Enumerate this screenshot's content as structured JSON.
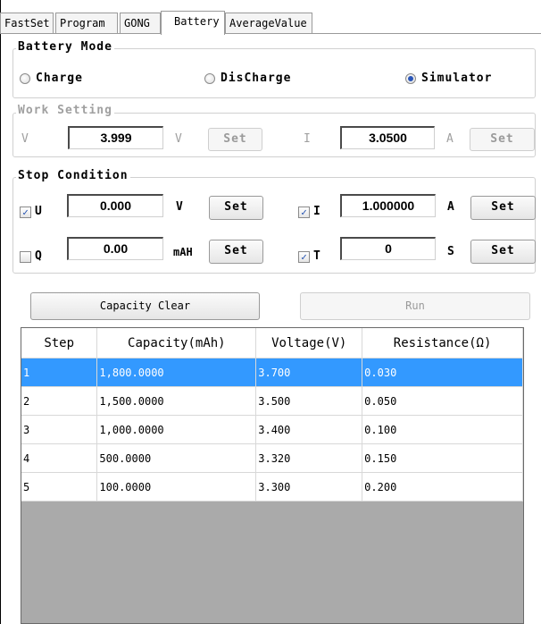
{
  "tabs": [
    {
      "label": "FastSet"
    },
    {
      "label": "Program"
    },
    {
      "label": "GONG"
    },
    {
      "label": "Battery"
    },
    {
      "label": "AverageValue"
    }
  ],
  "active_tab": "Battery",
  "battery_mode": {
    "title": "Battery Mode",
    "options": [
      "Charge",
      "DisCharge",
      "Simulator"
    ],
    "selected": "Simulator"
  },
  "work_setting": {
    "title": "Work Setting",
    "v_label": "V",
    "v_value": "3.999",
    "v_unit": "V",
    "v_set": "Set",
    "i_label": "I",
    "i_value": "3.0500",
    "i_unit": "A",
    "i_set": "Set"
  },
  "stop_condition": {
    "title": "Stop Condition",
    "u": {
      "label": "U",
      "checked": true,
      "value": "0.000",
      "unit": "V",
      "set": "Set"
    },
    "i": {
      "label": "I",
      "checked": true,
      "value": "1.000000",
      "unit": "A",
      "set": "Set"
    },
    "q": {
      "label": "Q",
      "checked": false,
      "value": "0.00",
      "unit": "mAH",
      "set": "Set"
    },
    "t": {
      "label": "T",
      "checked": true,
      "value": "0",
      "unit": "S",
      "set": "Set"
    }
  },
  "actions": {
    "capacity_clear": "Capacity Clear",
    "run": "Run"
  },
  "table": {
    "headers": [
      "Step",
      "Capacity(mAh)",
      "Voltage(V)",
      "Resistance(Ω)"
    ],
    "rows": [
      [
        "1",
        "1,800.0000",
        "3.700",
        "0.030"
      ],
      [
        "2",
        "1,500.0000",
        "3.500",
        "0.050"
      ],
      [
        "3",
        "1,000.0000",
        "3.400",
        "0.100"
      ],
      [
        "4",
        "500.0000",
        "3.320",
        "0.150"
      ],
      [
        "5",
        "100.0000",
        "3.300",
        "0.200"
      ]
    ],
    "selected_row": 0
  },
  "colors": {
    "selection": "#3399ff",
    "grid_bg": "#aaaaaa",
    "radio_dot": "#2a56b8"
  }
}
